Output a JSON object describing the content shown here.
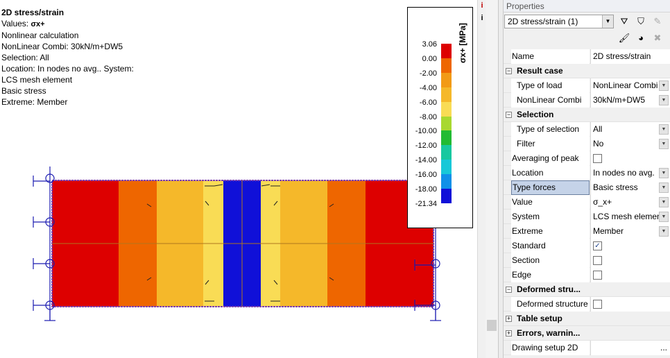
{
  "viewport": {
    "title": "2D stress/strain",
    "values_label": "Values:",
    "values_symbol": "σx+",
    "lines": [
      "Nonlinear calculation",
      "NonLinear Combi: 30kN/m+DW5",
      "Selection: All",
      "Location: In nodes no avg.. System:",
      "LCS mesh element",
      "Basic stress",
      "Extreme: Member"
    ],
    "legend": {
      "title": "σx+ [MPa]",
      "ticks": [
        "3.06",
        "0.00",
        "-2.00",
        "-4.00",
        "-6.00",
        "-8.00",
        "-10.00",
        "-12.00",
        "-14.00",
        "-16.00",
        "-18.00",
        "-21.34"
      ],
      "colors": [
        "#dd0000",
        "#ee6600",
        "#f29a16",
        "#f5b82a",
        "#f9dc55",
        "#a8d830",
        "#22bb33",
        "#18c8a0",
        "#18c8d8",
        "#1090e8",
        "#1010d8"
      ]
    },
    "info_icon": "i",
    "info_icon2": "i"
  },
  "properties": {
    "title": "Properties",
    "selector_value": "2D stress/strain (1)",
    "rows": [
      {
        "type": "prop",
        "label": "Name",
        "value": "2D stress/strain"
      },
      {
        "type": "section",
        "label": "Result case"
      },
      {
        "type": "prop",
        "label": "Type of load",
        "value": "NonLinear Combi",
        "dropdown": true,
        "indent": true
      },
      {
        "type": "prop",
        "label": "NonLinear Combi",
        "value": "30kN/m+DW5",
        "dropdown": true,
        "indent": true
      },
      {
        "type": "section",
        "label": "Selection"
      },
      {
        "type": "prop",
        "label": "Type of selection",
        "value": "All",
        "dropdown": true,
        "indent": true
      },
      {
        "type": "prop",
        "label": "Filter",
        "value": "No",
        "dropdown": true,
        "indent": true
      },
      {
        "type": "check",
        "label": "Averaging of peak",
        "checked": false
      },
      {
        "type": "prop",
        "label": "Location",
        "value": "In nodes no avg.",
        "dropdown": true
      },
      {
        "type": "prop",
        "label": "Type forces",
        "value": "Basic stress",
        "dropdown": true,
        "selected": true
      },
      {
        "type": "prop",
        "label": "Value",
        "value": "σ_x+",
        "dropdown": true
      },
      {
        "type": "prop",
        "label": "System",
        "value": "LCS mesh element",
        "dropdown": true
      },
      {
        "type": "prop",
        "label": "Extreme",
        "value": "Member",
        "dropdown": true
      },
      {
        "type": "check",
        "label": "Standard",
        "checked": true
      },
      {
        "type": "check",
        "label": "Section",
        "checked": false
      },
      {
        "type": "check",
        "label": "Edge",
        "checked": false
      },
      {
        "type": "section",
        "label": "Deformed stru..."
      },
      {
        "type": "check",
        "label": "Deformed structure",
        "checked": false,
        "indent": true
      },
      {
        "type": "section",
        "label": "Table setup",
        "collapsed": true
      },
      {
        "type": "section",
        "label": "Errors, warnin...",
        "collapsed": true
      },
      {
        "type": "button",
        "label": "Drawing setup 2D",
        "value": "..."
      }
    ]
  }
}
